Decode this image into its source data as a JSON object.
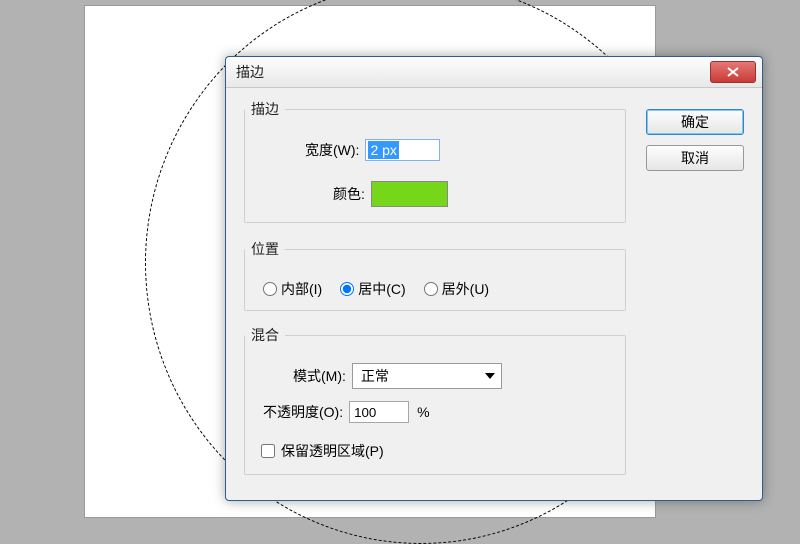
{
  "dialog": {
    "title": "描边",
    "ok_label": "确定",
    "cancel_label": "取消"
  },
  "stroke_group": {
    "legend": "描边",
    "width_label": "宽度(W):",
    "width_value": "2 px",
    "color_label": "颜色:",
    "color_value": "#76D61A"
  },
  "position_group": {
    "legend": "位置",
    "options": {
      "inside": "内部(I)",
      "center": "居中(C)",
      "outside": "居外(U)"
    },
    "selected": "center"
  },
  "blend_group": {
    "legend": "混合",
    "mode_label": "模式(M):",
    "mode_value": "正常",
    "opacity_label": "不透明度(O):",
    "opacity_value": "100",
    "opacity_unit": "%",
    "preserve_label": "保留透明区域(P)",
    "preserve_checked": false
  }
}
